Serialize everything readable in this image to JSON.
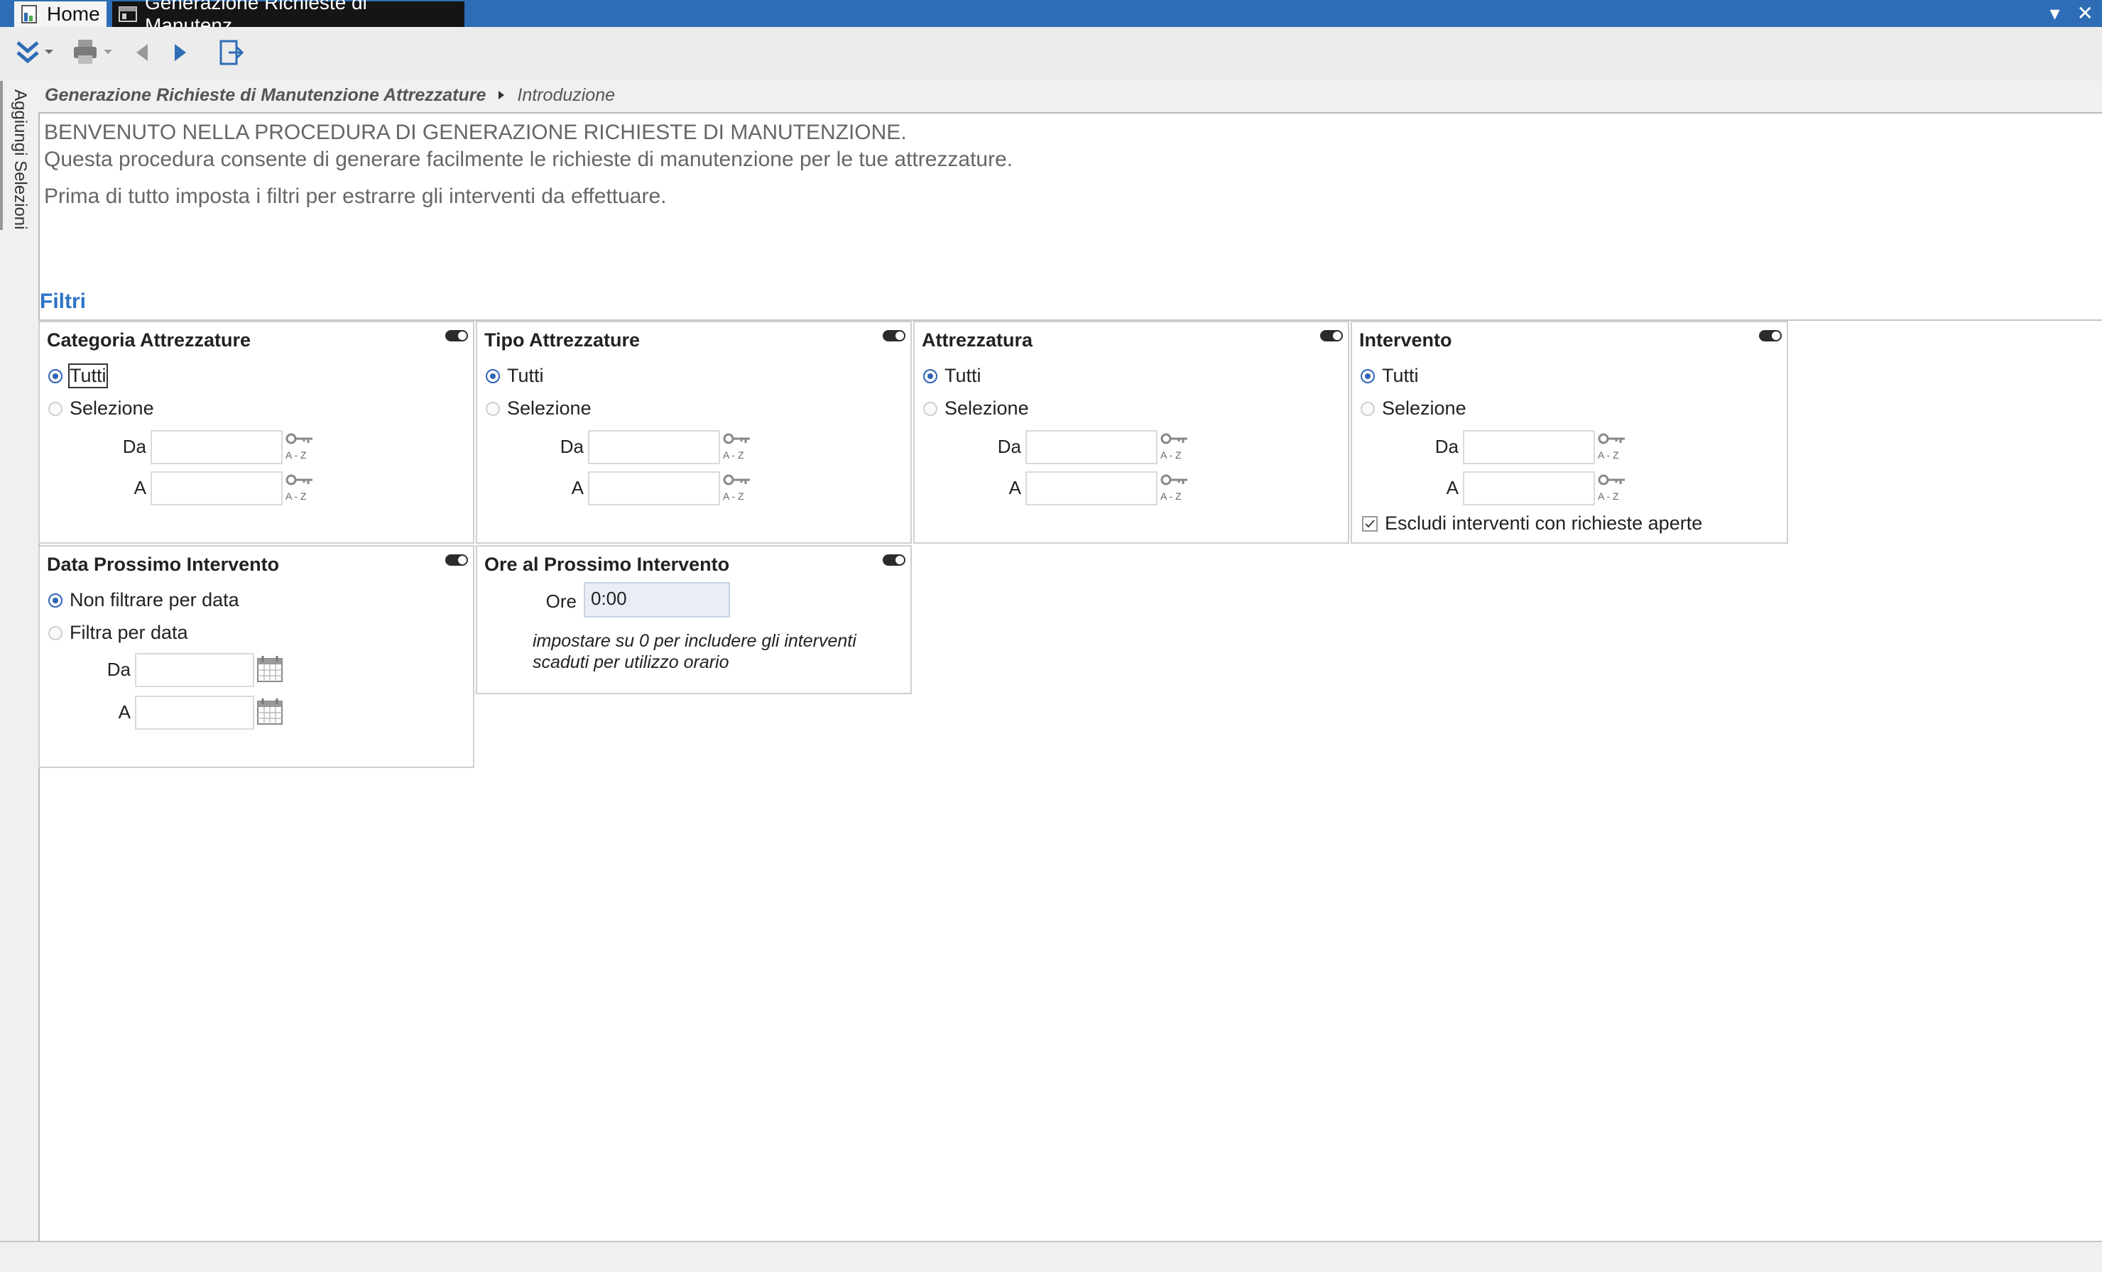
{
  "window": {
    "tabs": [
      {
        "label": "Home",
        "active": false
      },
      {
        "label": "Generazione Richieste di Manutenz...",
        "active": true
      }
    ],
    "controls": {
      "dropdown": "▾",
      "close": "✕"
    }
  },
  "toolbar": {
    "icons": [
      "collapse-icon",
      "print-icon",
      "back-icon",
      "forward-icon",
      "exit-icon"
    ]
  },
  "siderail": {
    "label": "Aggiungi Selezioni"
  },
  "breadcrumb": {
    "parent": "Generazione Richieste di Manutenzione Attrezzature",
    "current": "Introduzione"
  },
  "intro": {
    "line1": "BENVENUTO NELLA PROCEDURA DI GENERAZIONE RICHIESTE DI MANUTENZIONE.",
    "line2": "Questa procedura consente di generare facilmente le richieste di manutenzione per le tue attrezzature.",
    "line3": "Prima di tutto imposta i filtri per estrarre gli interventi da effettuare."
  },
  "filters": {
    "section_title": "Filtri",
    "categoria": {
      "title": "Categoria Attrezzature",
      "opt_all": "Tutti",
      "opt_sel": "Selezione",
      "from_label": "Da",
      "to_label": "A",
      "selected": "Tutti"
    },
    "tipo": {
      "title": "Tipo Attrezzature",
      "opt_all": "Tutti",
      "opt_sel": "Selezione",
      "from_label": "Da",
      "to_label": "A",
      "selected": "Tutti"
    },
    "attrezzatura": {
      "title": "Attrezzatura",
      "opt_all": "Tutti",
      "opt_sel": "Selezione",
      "from_label": "Da",
      "to_label": "A",
      "selected": "Tutti"
    },
    "intervento": {
      "title": "Intervento",
      "opt_all": "Tutti",
      "opt_sel": "Selezione",
      "from_label": "Da",
      "to_label": "A",
      "selected": "Tutti",
      "exclude_label": "Escludi interventi con richieste aperte",
      "exclude_checked": true
    },
    "data": {
      "title": "Data Prossimo Intervento",
      "opt_none": "Non filtrare per data",
      "opt_filter": "Filtra per data",
      "from_label": "Da",
      "to_label": "A",
      "selected": "Non filtrare per data"
    },
    "ore": {
      "title": "Ore al Prossimo Intervento",
      "label": "Ore",
      "value": "0:00",
      "hint": "impostare su 0 per includere gli interventi scaduti per utilizzo orario"
    }
  },
  "colors": {
    "titlebar": "#2e6db5",
    "accent": "#2d72c4",
    "radio_selected": "#2f63b5"
  }
}
